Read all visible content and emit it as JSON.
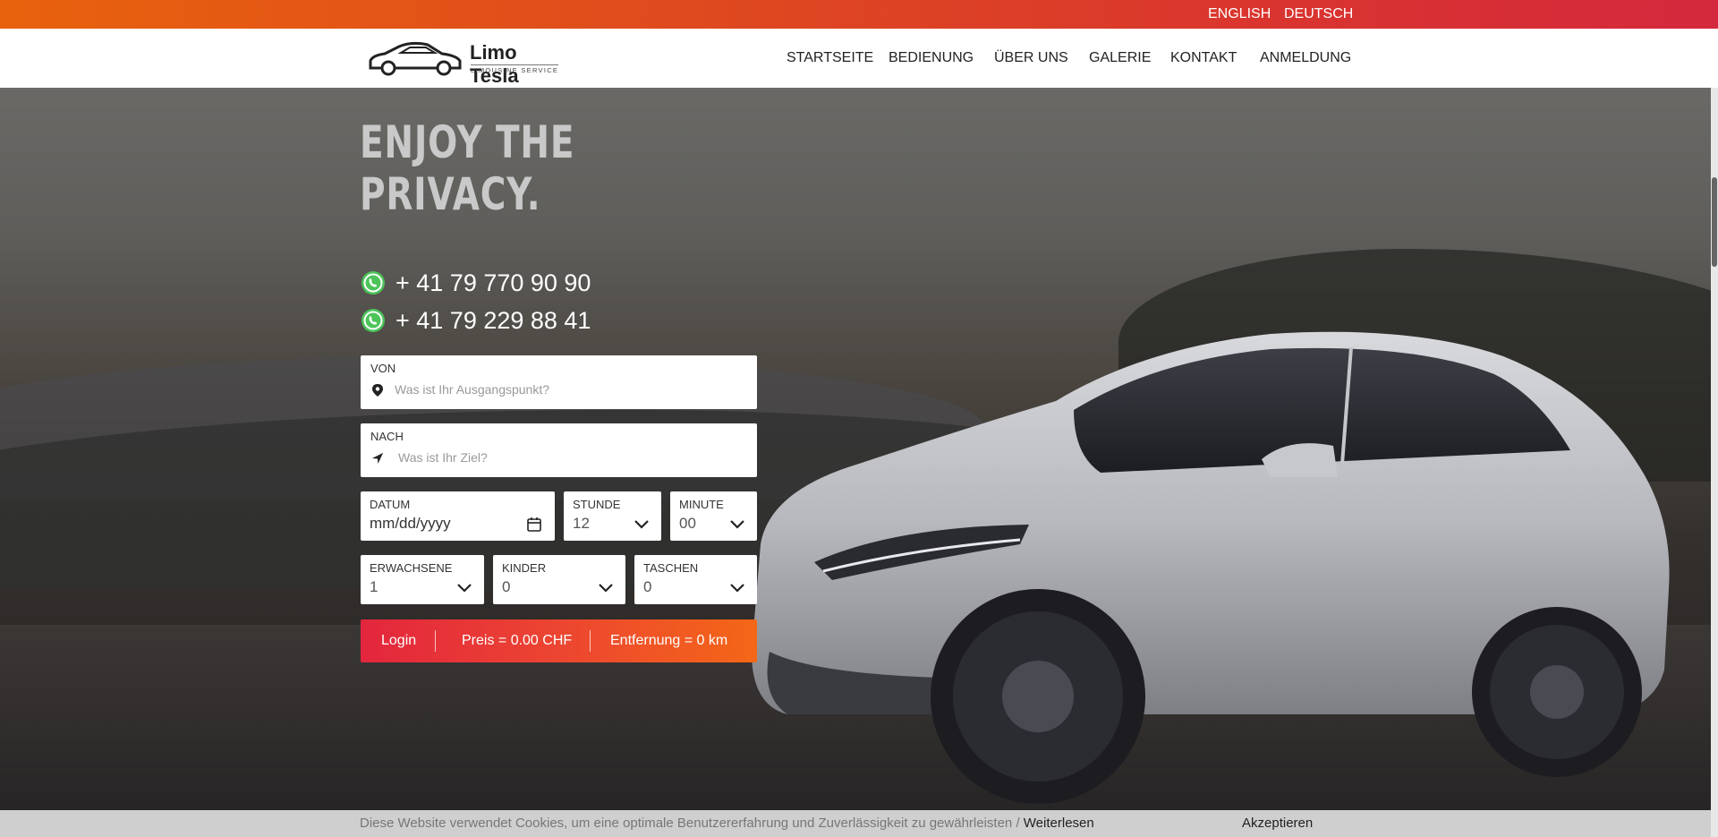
{
  "languages": {
    "english": "ENGLISH",
    "deutsch": "DEUTSCH"
  },
  "brand": {
    "name": "Limo Tesla",
    "tagline": "LIMOUSINE SERVICE"
  },
  "nav": {
    "items": [
      "STARTSEITE",
      "BEDIENUNG",
      "ÜBER UNS",
      "GALERIE",
      "KONTAKT",
      "ANMELDUNG"
    ]
  },
  "hero": {
    "headline_line1": "ENJOY THE",
    "headline_line2": "PRIVACY.",
    "phones": [
      "+ 41 79 770 90 90",
      "+ 41 79 229 88 41"
    ]
  },
  "form": {
    "from": {
      "label": "VON",
      "placeholder": "Was ist Ihr Ausgangspunkt?"
    },
    "to": {
      "label": "NACH",
      "placeholder": "Was ist Ihr Ziel?"
    },
    "date": {
      "label": "DATUM",
      "value": "mm/dd/yyyy"
    },
    "hour": {
      "label": "STUNDE",
      "value": "12"
    },
    "minute": {
      "label": "MINUTE",
      "value": "00"
    },
    "adults": {
      "label": "ERWACHSENE",
      "value": "1"
    },
    "children": {
      "label": "KINDER",
      "value": "0"
    },
    "bags": {
      "label": "TASCHEN",
      "value": "0"
    },
    "login_label": "Login",
    "price_text": "Preis = 0.00 CHF",
    "distance_text": "Entfernung = 0 km"
  },
  "cookie": {
    "text": "Diese Website verwendet Cookies, um eine optimale Benutzererfahrung und Zuverlässigkeit zu gewährleisten",
    "separator": " / ",
    "more": "Weiterlesen",
    "accept": "Akzeptieren"
  },
  "colors": {
    "accent_start": "#e3263d",
    "accent_end": "#f46717",
    "topbar_start": "#e8620d",
    "topbar_end": "#d4283d"
  }
}
